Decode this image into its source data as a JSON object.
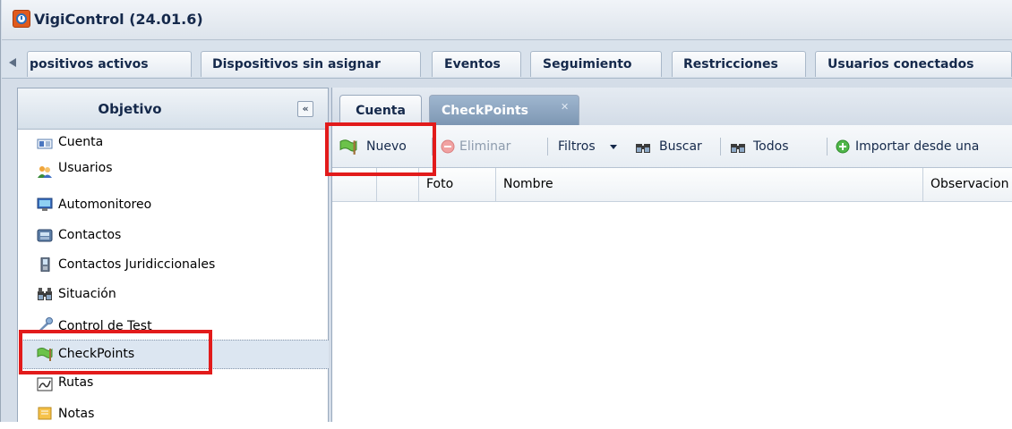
{
  "window": {
    "title": "VigiControl (24.01.6)"
  },
  "top_tabs": [
    {
      "label": "positivos activos"
    },
    {
      "label": "Dispositivos sin asignar"
    },
    {
      "label": "Eventos"
    },
    {
      "label": "Seguimiento"
    },
    {
      "label": "Restricciones"
    },
    {
      "label": "Usuarios conectados"
    }
  ],
  "left_panel": {
    "title": "Objetivo",
    "collapse_label": "«",
    "items": [
      {
        "label": "Cuenta",
        "icon": "account-card-icon"
      },
      {
        "label": "Usuarios",
        "icon": "users-icon"
      },
      {
        "label": "Automonitoreo",
        "icon": "monitor-icon"
      },
      {
        "label": "Contactos",
        "icon": "phone-icon"
      },
      {
        "label": "Contactos Juridiccionales",
        "icon": "mobile-icon"
      },
      {
        "label": "Situación",
        "icon": "binoculars-icon"
      },
      {
        "label": "Control de Test",
        "icon": "test-tool-icon"
      },
      {
        "label": "CheckPoints",
        "icon": "flag-icon",
        "selected": true
      },
      {
        "label": "Rutas",
        "icon": "map-route-icon"
      },
      {
        "label": "Notas",
        "icon": "note-icon"
      }
    ]
  },
  "content_tabs": [
    {
      "label": "Cuenta",
      "active": false
    },
    {
      "label": "CheckPoints",
      "active": true,
      "close_label": "✕"
    }
  ],
  "toolbar": {
    "nuevo": "Nuevo",
    "eliminar": "Eliminar",
    "filtros": "Filtros",
    "buscar": "Buscar",
    "todos": "Todos",
    "importar": "Importar desde una"
  },
  "grid": {
    "columns": [
      "",
      "",
      "Foto",
      "Nombre",
      "Observacion"
    ]
  },
  "colors": {
    "highlight": "#e21b1b",
    "title_text": "#15294b",
    "active_tab": "#7d97b3"
  }
}
